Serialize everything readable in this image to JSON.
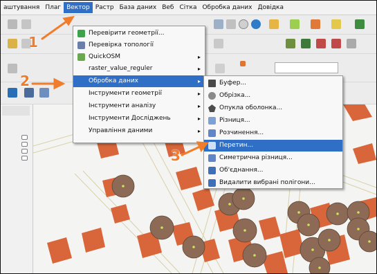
{
  "menubar": {
    "items": [
      "аштування",
      "Плаг",
      "Вектор",
      "Растр",
      "База даних",
      "Веб",
      "Сітка",
      "Обробка даних",
      "Довідка"
    ],
    "active_index": 2
  },
  "vector_menu": {
    "items": [
      {
        "label": "Перевірити геометрії...",
        "icon": "check-geometry-icon",
        "submenu": false
      },
      {
        "label": "Перевірка топології",
        "icon": "topology-icon",
        "submenu": false
      },
      {
        "label": "QuickOSM",
        "icon": "quickosm-icon",
        "submenu": true
      },
      {
        "label": "raster_value_reguler",
        "icon": "",
        "submenu": true
      },
      {
        "label": "Обробка даних",
        "icon": "",
        "submenu": true,
        "highlighted": true
      },
      {
        "label": "Інструменти геометрії",
        "icon": "",
        "submenu": true
      },
      {
        "label": "Інструменти аналізу",
        "icon": "",
        "submenu": true
      },
      {
        "label": "Інструменти Досліджень",
        "icon": "",
        "submenu": true
      },
      {
        "label": "Управління даними",
        "icon": "",
        "submenu": true
      }
    ]
  },
  "geoprocessing_menu": {
    "items": [
      {
        "label": "Буфер...",
        "icon": "buffer-icon"
      },
      {
        "label": "Обрізка...",
        "icon": "clip-icon"
      },
      {
        "label": "Опукла оболонка...",
        "icon": "convex-hull-icon"
      },
      {
        "label": "Різниця...",
        "icon": "difference-icon"
      },
      {
        "label": "Розчинення...",
        "icon": "dissolve-icon"
      },
      {
        "label": "Перетин...",
        "icon": "intersection-icon",
        "highlighted": true
      },
      {
        "label": "Симетрична різниця...",
        "icon": "sym-difference-icon"
      },
      {
        "label": "Об'єднання...",
        "icon": "union-icon"
      },
      {
        "label": "Видалити вибрані полігони...",
        "icon": "eliminate-icon"
      }
    ]
  },
  "annotations": {
    "step1": "1",
    "step2": "2",
    "step3": "3"
  },
  "colors": {
    "accent": "#2f6fc6",
    "annotation": "#f07d2b",
    "building": "#d8663a",
    "buffer": "#8c6a56"
  }
}
